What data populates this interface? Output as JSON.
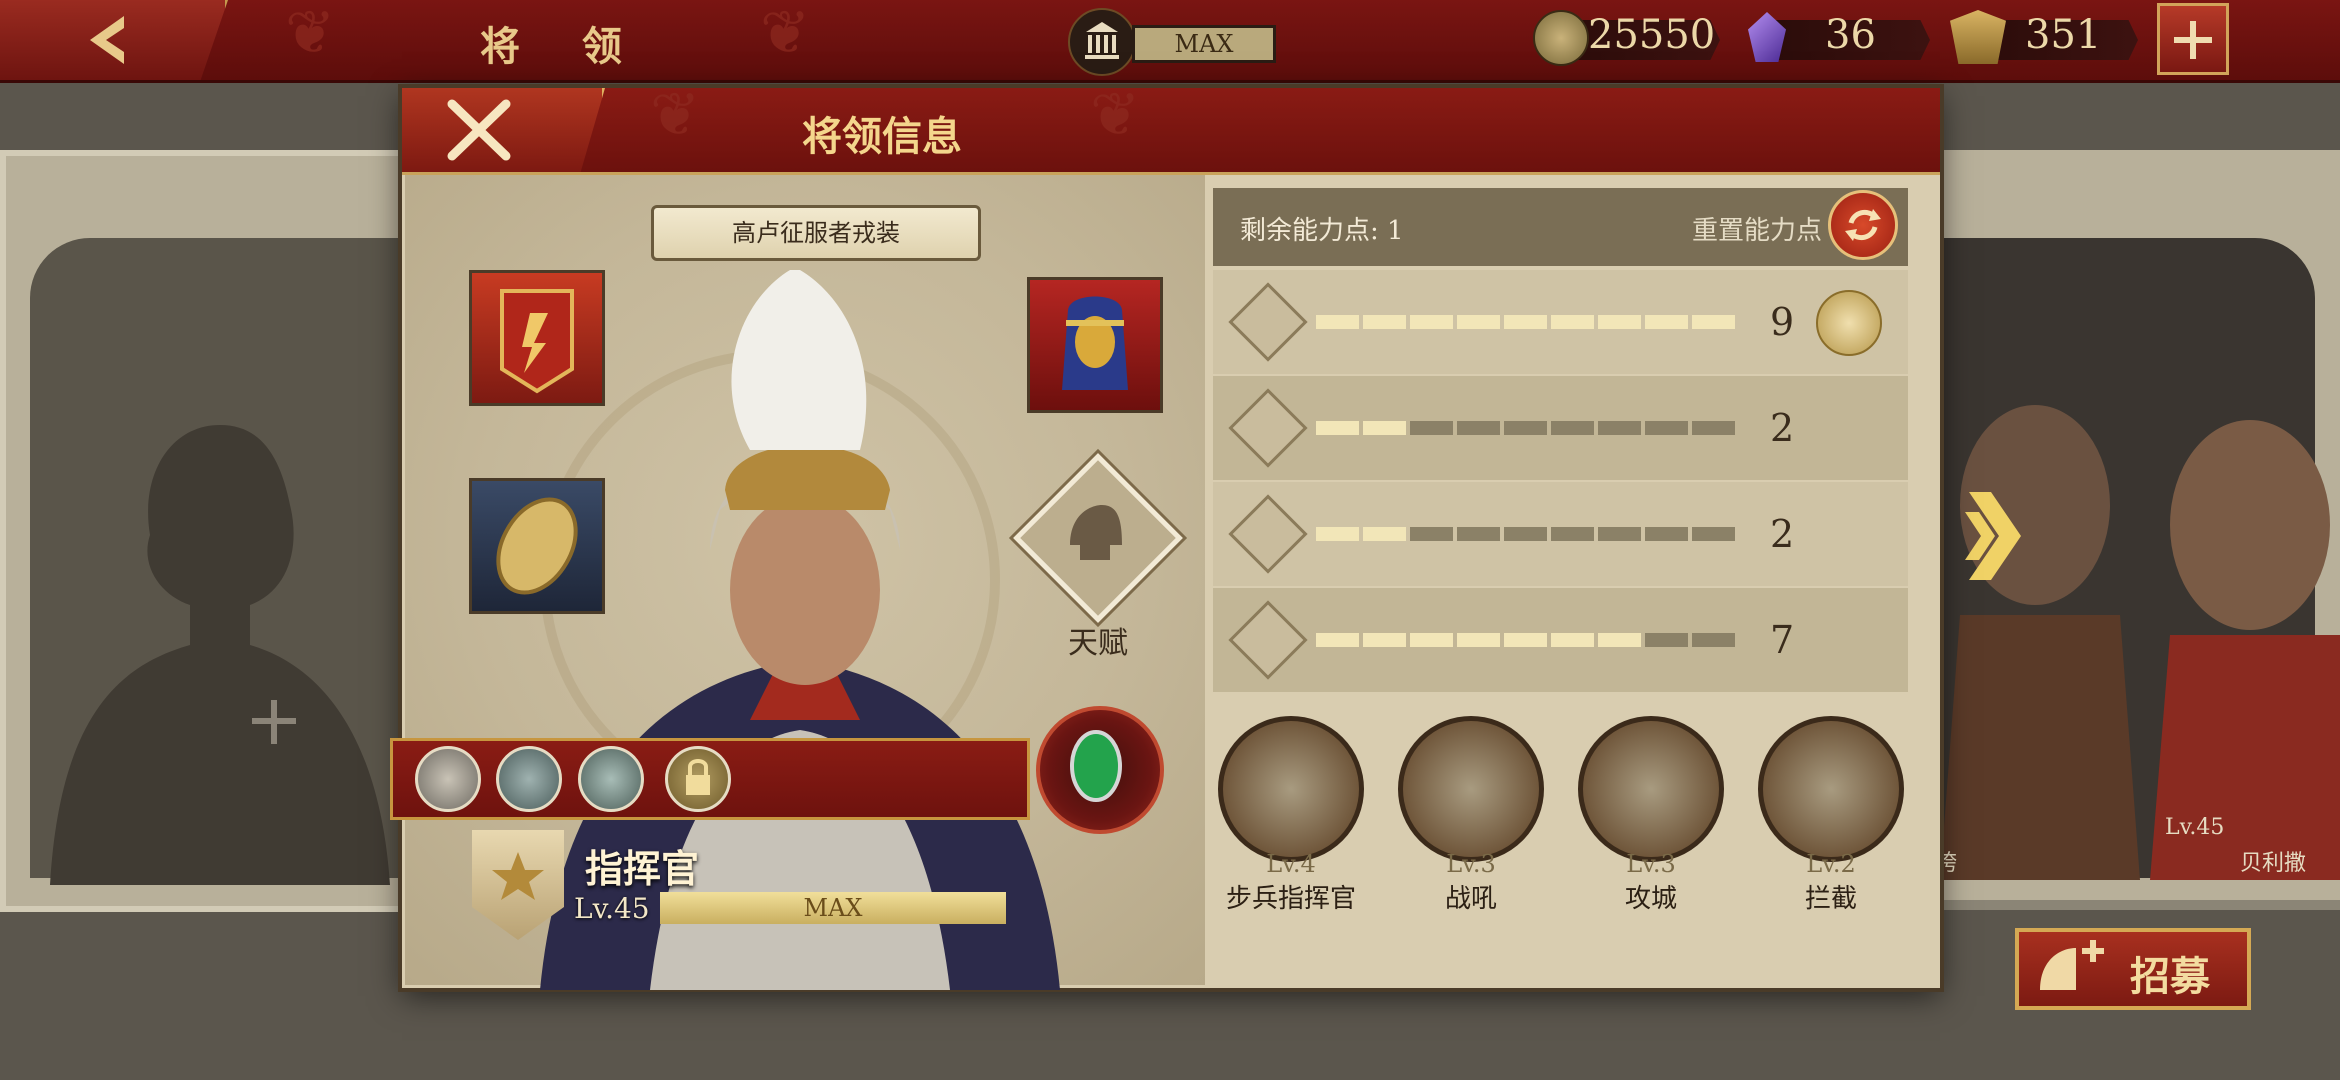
{
  "header": {
    "title": "将 领",
    "building_level": "MAX",
    "resources": [
      {
        "name": "coin",
        "icon": "coin-icon",
        "value": "25550"
      },
      {
        "name": "gem",
        "icon": "purple-crystal-icon",
        "value": "36"
      },
      {
        "name": "spqr",
        "icon": "spqr-eagle-icon",
        "value": "351"
      }
    ]
  },
  "modal": {
    "title": "将领信息",
    "outfit_label": "高卢征服者戎装",
    "talent_label": "天赋",
    "rank_name": "指挥官",
    "level_text": "Lv.45",
    "level_bar_text": "MAX"
  },
  "abilities": {
    "remaining_label": "剩余能力点: 1",
    "reset_label": "重置能力点",
    "rows": [
      {
        "icon": "sword-icon",
        "value": "9",
        "fill": 9
      },
      {
        "icon": "horse-icon",
        "value": "2",
        "fill": 2
      },
      {
        "icon": "bow-icon",
        "value": "2",
        "fill": 2
      },
      {
        "icon": "anchor-icon",
        "value": "7",
        "fill": 7
      }
    ],
    "segments_total": 9
  },
  "skills": [
    {
      "level": "Lv.4",
      "name": "步兵指挥官",
      "icon": "crossed-swords-icon"
    },
    {
      "level": "Lv.3",
      "name": "战吼",
      "icon": "shouting-soldier-icon"
    },
    {
      "level": "Lv.3",
      "name": "攻城",
      "icon": "siege-ladder-icon"
    },
    {
      "level": "Lv.2",
      "name": "拦截",
      "icon": "archer-icon"
    }
  ],
  "side": {
    "right_general_level": "Lv.45",
    "right_general_name": "贝利撒",
    "right_general2_name": "垮",
    "recruit_label": "招募"
  },
  "colors": {
    "header_red": "#6c110d",
    "gold": "#c9a25a",
    "panel_bg": "#d9cdb0"
  }
}
